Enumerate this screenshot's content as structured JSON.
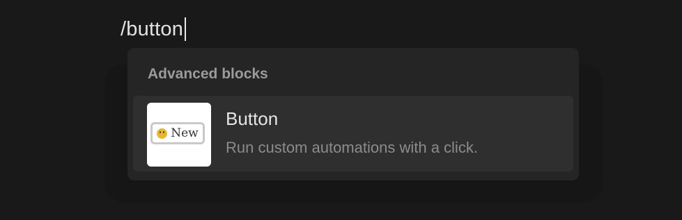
{
  "editor": {
    "typed_text": "/button"
  },
  "slash_menu": {
    "section_title": "Advanced blocks",
    "items": [
      {
        "title": "Button",
        "description": "Run custom automations with a click.",
        "thumbnail": {
          "label": "New",
          "icon": "smiley-icon",
          "icon_color": "#e6b637"
        }
      }
    ]
  },
  "colors": {
    "background": "#191919",
    "menu_background": "#252525",
    "item_highlight": "#2f2f2f"
  }
}
